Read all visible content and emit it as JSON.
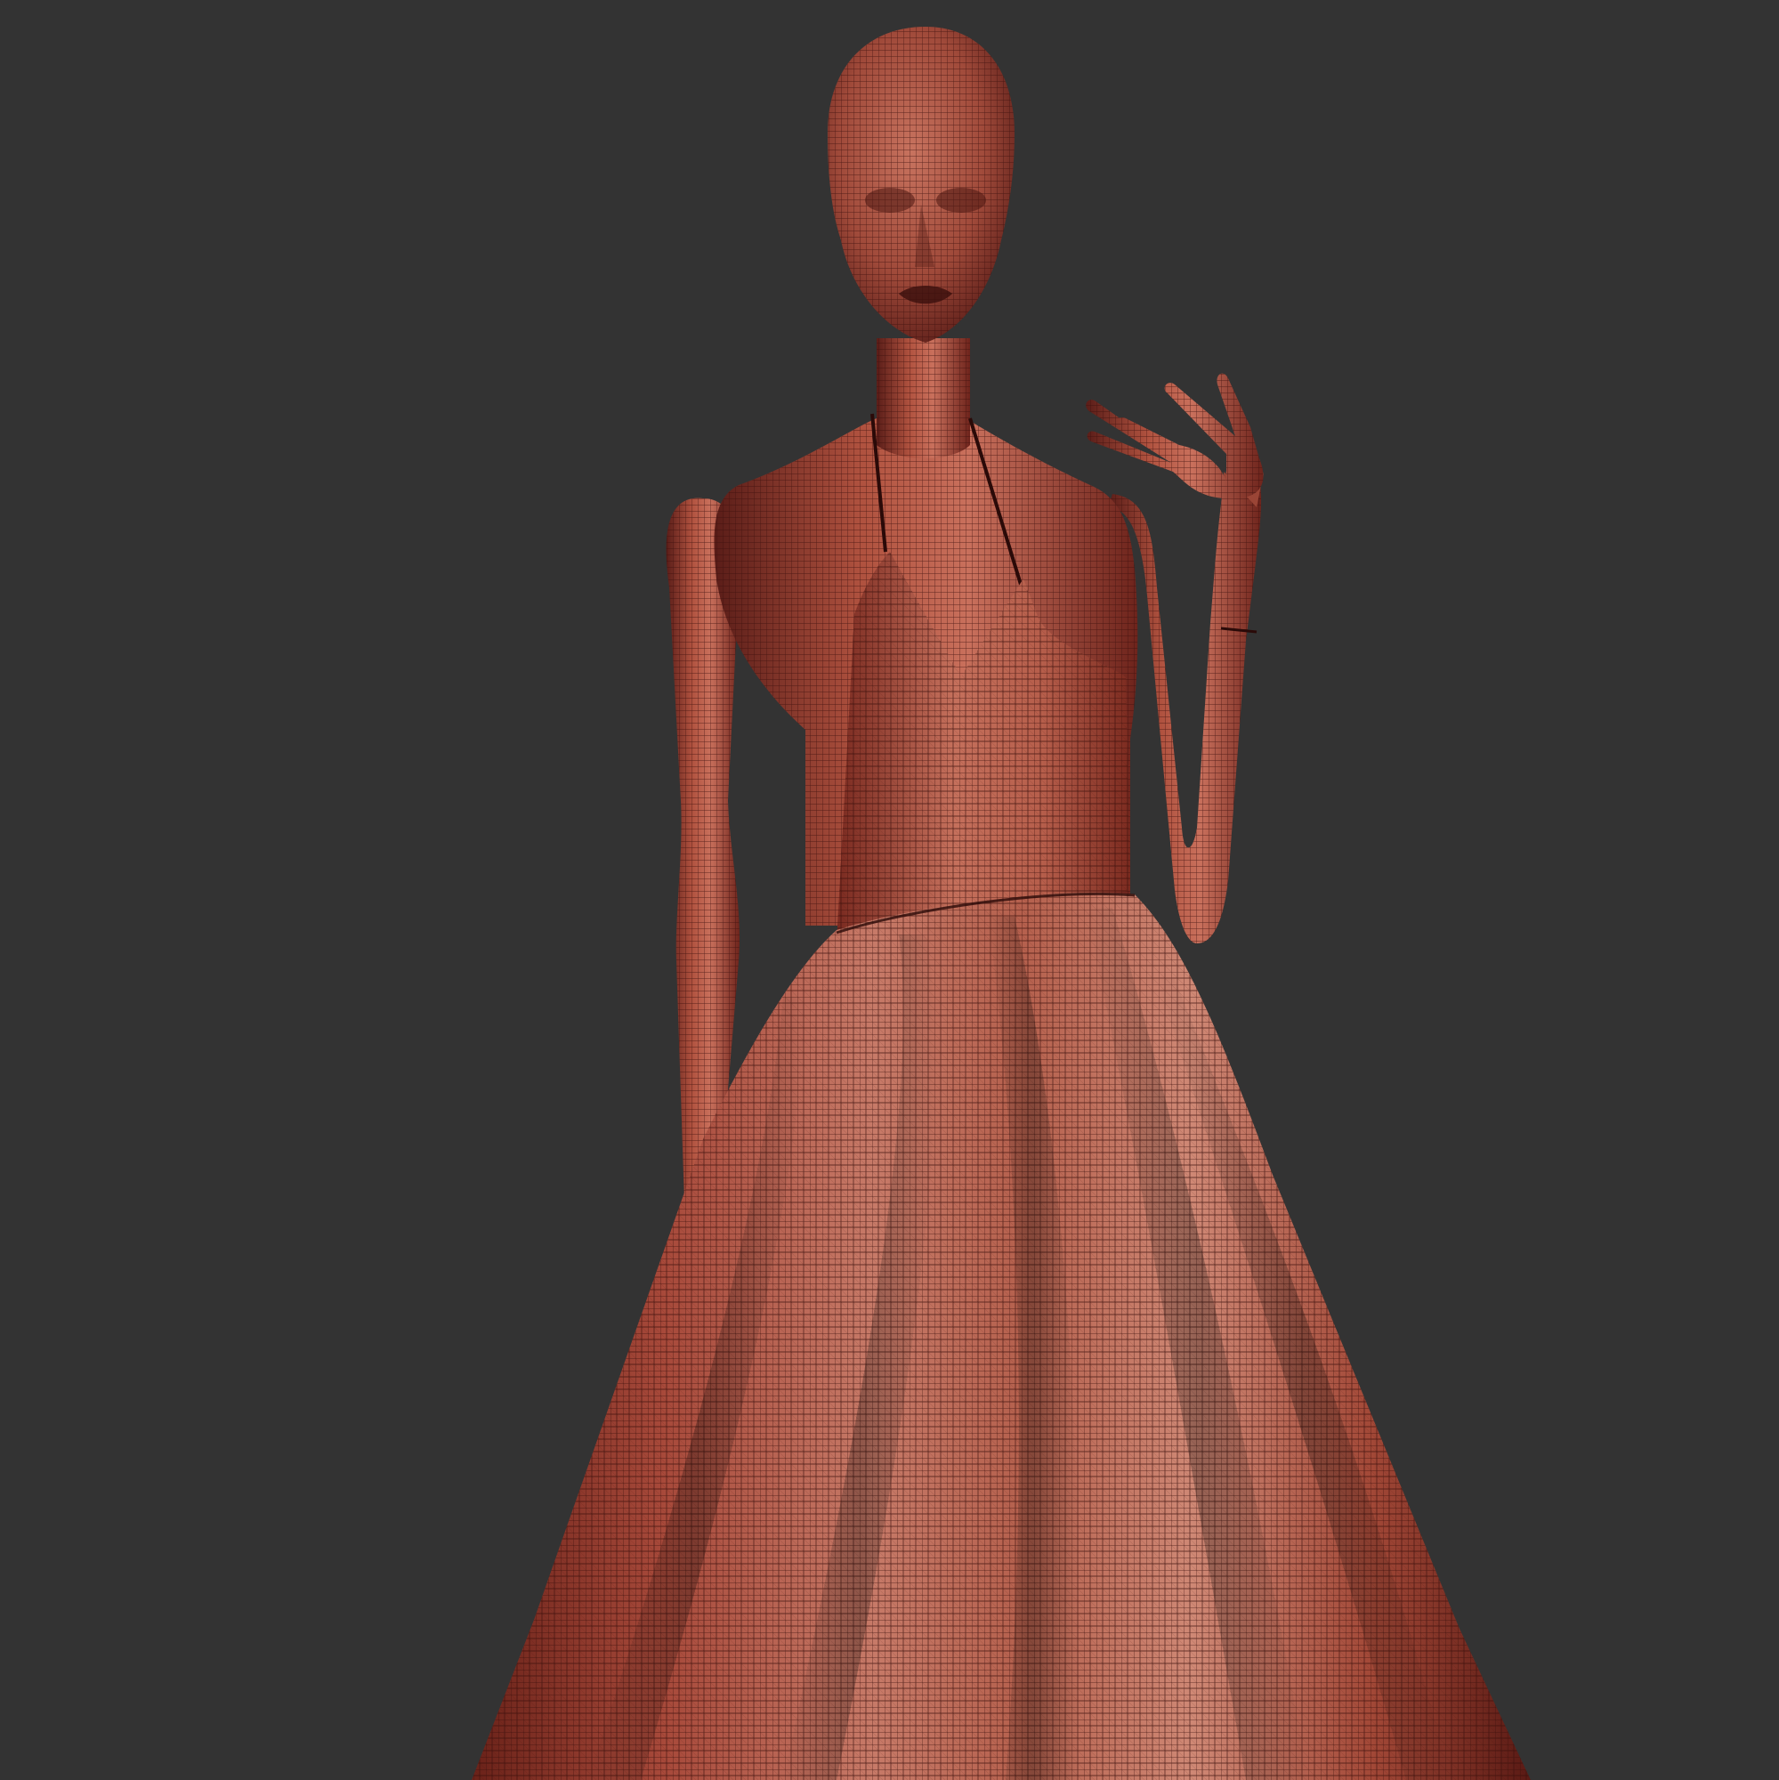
{
  "viewport": {
    "background_color": "#333333"
  },
  "model": {
    "subject": "mannequin-in-dress-wireframe",
    "shading": "wireframe-on-shaded",
    "colors": {
      "base": "#a8483c",
      "highlight": "#d38674",
      "shadow": "#5a1d18",
      "wire": "#3a0f0c"
    }
  }
}
